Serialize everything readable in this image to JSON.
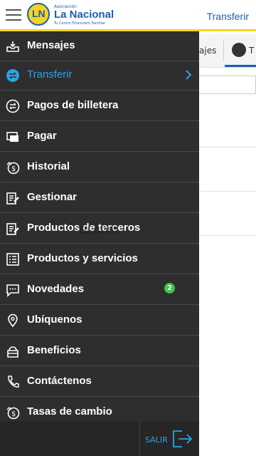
{
  "header": {
    "logo_small": "Asociación",
    "logo_name": "La Nacional",
    "logo_tagline": "Tu Centro Financiero Familiar",
    "logo_mark": "LN",
    "title": "Transferir"
  },
  "background": {
    "tab1_label": "ajes",
    "tab2_label": "T"
  },
  "menu": {
    "items": [
      {
        "label": "Mensajes",
        "icon": "inbox-icon"
      },
      {
        "label": "Transferir",
        "icon": "transfer-icon",
        "active": true
      },
      {
        "label": "Pagos de billetera",
        "icon": "wallet-exchange-icon"
      },
      {
        "label": "Pagar",
        "icon": "pay-icon"
      },
      {
        "label": "Historial",
        "icon": "history-icon"
      },
      {
        "label": "Gestionar",
        "icon": "manage-icon"
      },
      {
        "label": "Productos de terceros",
        "icon": "third-party-icon"
      },
      {
        "label": "Productos y servicios",
        "icon": "products-icon"
      },
      {
        "label": "Novedades",
        "icon": "chat-icon",
        "badge": "2"
      },
      {
        "label": "Ubíquenos",
        "icon": "location-icon"
      },
      {
        "label": "Beneficios",
        "icon": "benefits-icon"
      },
      {
        "label": "Contáctenos",
        "icon": "phone-icon"
      },
      {
        "label": "Tasas de cambio",
        "icon": "exchange-rate-icon"
      }
    ]
  },
  "bottom": {
    "salir_label": "SALIR"
  },
  "watermark": "ar.com",
  "colors": {
    "accent": "#2aa3e4",
    "brand_blue": "#1a5fb4",
    "brand_yellow": "#f5d320",
    "drawer_bg": "#2e2e2e",
    "badge_green": "#3fc24b"
  }
}
